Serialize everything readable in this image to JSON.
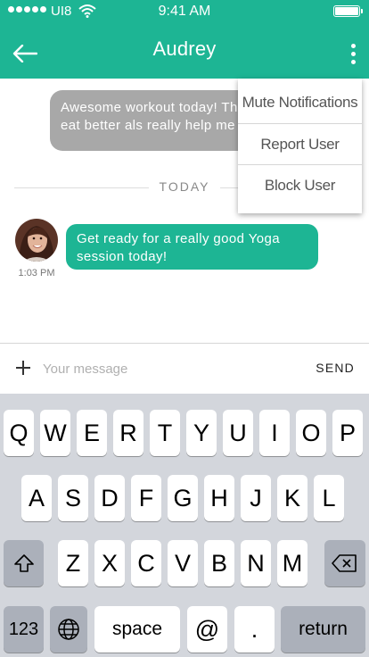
{
  "status_bar": {
    "carrier": "UI8",
    "time": "9:41 AM"
  },
  "header": {
    "title": "Audrey"
  },
  "menu": {
    "items": [
      "Mute Notifications",
      "Report User",
      "Block User"
    ]
  },
  "chat": {
    "outgoing": {
      "text": "Awesome workout today! Th tips on how to eat better als really help me reach my goa"
    },
    "divider_label": "TODAY",
    "incoming": {
      "text": "Get ready for a really good Yoga session today!",
      "time": "1:03 PM"
    }
  },
  "composer": {
    "placeholder": "Your message",
    "send_label": "SEND"
  },
  "keyboard": {
    "row1": [
      "Q",
      "W",
      "E",
      "R",
      "T",
      "Y",
      "U",
      "I",
      "O",
      "P"
    ],
    "row2": [
      "A",
      "S",
      "D",
      "F",
      "G",
      "H",
      "J",
      "K",
      "L"
    ],
    "row3": [
      "Z",
      "X",
      "C",
      "V",
      "B",
      "N",
      "M"
    ],
    "numbers_label": "123",
    "space_label": "space",
    "at_label": "@",
    "dot_label": ".",
    "return_label": "return"
  },
  "colors": {
    "accent": "#1db594",
    "outgoing_bubble": "#a8a8a8",
    "keyboard_bg": "#d3d6dc"
  }
}
